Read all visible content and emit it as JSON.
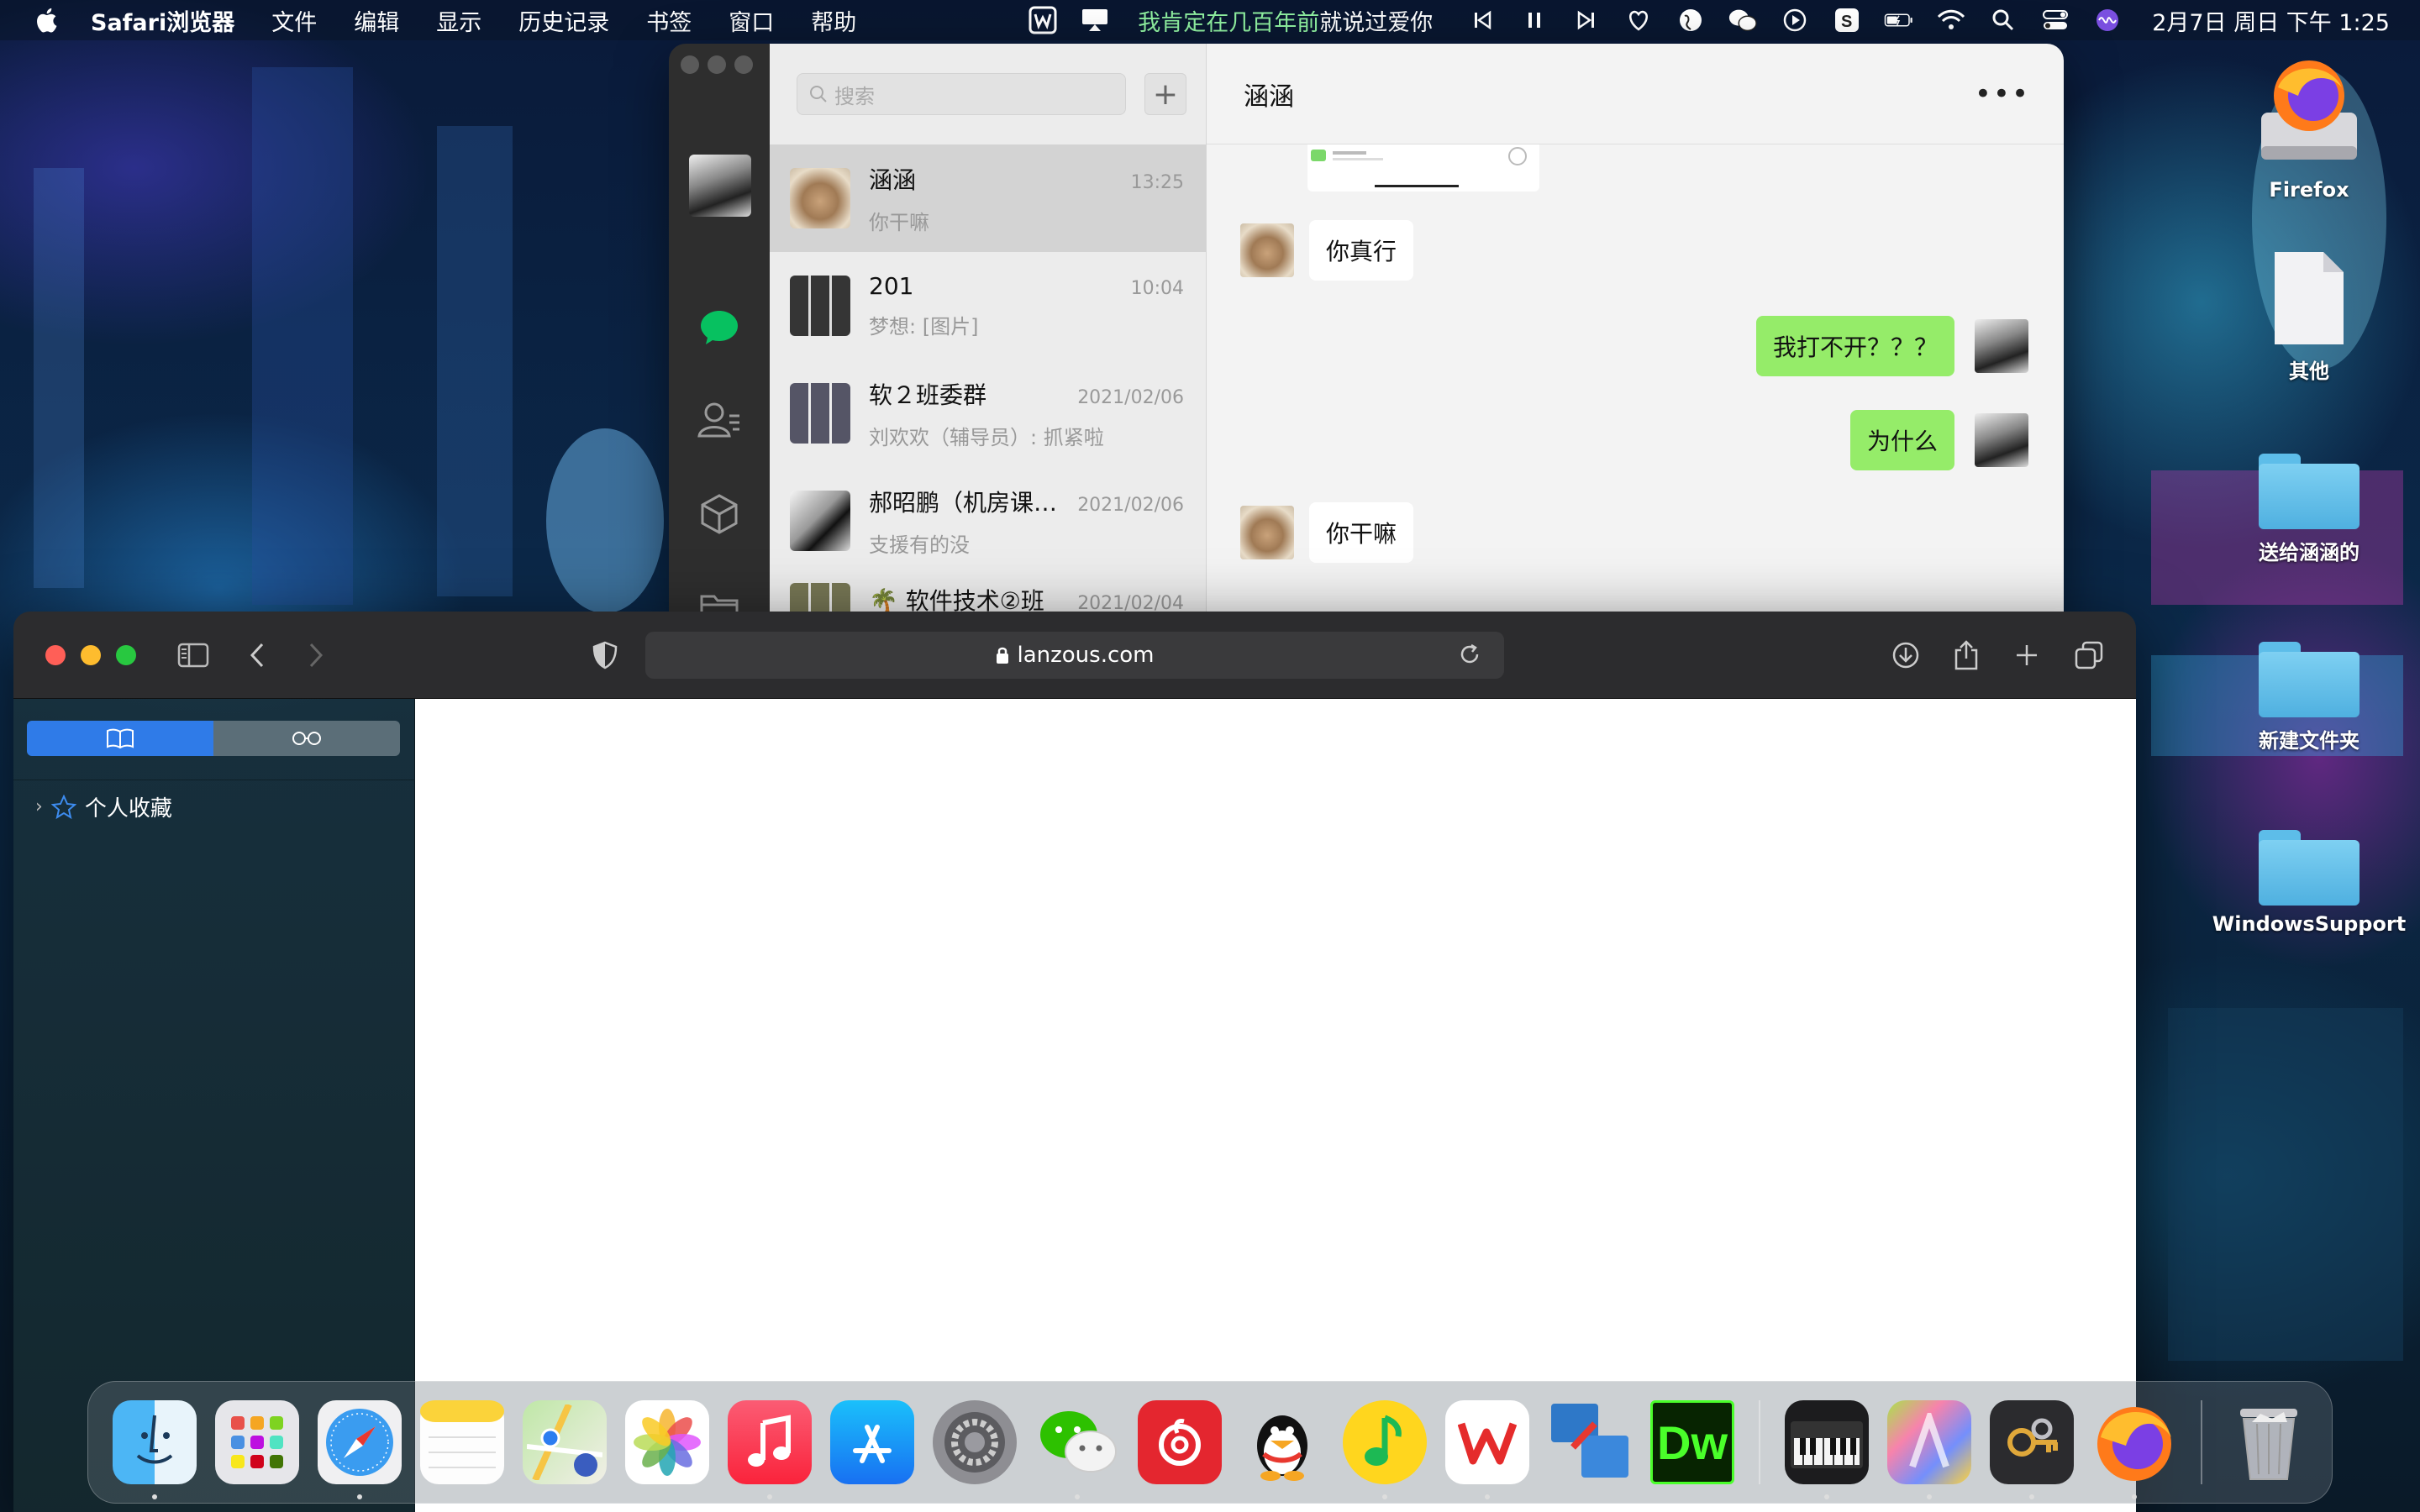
{
  "menubar": {
    "app_name": "Safari浏览器",
    "items": [
      "文件",
      "编辑",
      "显示",
      "历史记录",
      "书签",
      "窗口",
      "帮助"
    ],
    "song_highlight": "我肯定在几百年前",
    "song_rest": "就说过爱你",
    "clock": "2月7日 周日 下午 1:25"
  },
  "wechat": {
    "search_placeholder": "搜索",
    "add_label": "+",
    "conversations": [
      {
        "name": "涵涵",
        "time": "13:25",
        "message": "你干嘛"
      },
      {
        "name": "201",
        "time": "10:04",
        "message": "梦想: [图片]"
      },
      {
        "name": "软２班委群",
        "time": "2021/02/06",
        "message": "刘欢欢（辅导员）: 抓紧啦"
      },
      {
        "name": "郝昭鹏（机房课…",
        "time": "2021/02/06",
        "message": "支援有的没"
      },
      {
        "name": "🌴 软件技术②班",
        "time": "2021/02/04",
        "message": ""
      }
    ],
    "chat": {
      "title": "涵涵",
      "more": "•••",
      "messages": [
        {
          "from": "them",
          "text": "你真行"
        },
        {
          "from": "me",
          "text": "我打不开？？？"
        },
        {
          "from": "me",
          "text": "为什么"
        },
        {
          "from": "them",
          "text": "你干嘛"
        }
      ]
    }
  },
  "safari": {
    "url": "lanzous.com",
    "sidebar": {
      "favorites_label": "个人收藏",
      "chevron": "›"
    }
  },
  "desktop_icons": [
    {
      "label": "Firefox"
    },
    {
      "label": "其他"
    },
    {
      "label": "送给涵涵的"
    },
    {
      "label": "新建文件夹"
    },
    {
      "label": "WindowsSupport"
    }
  ],
  "dock": {
    "apps": [
      "finder-icon",
      "launchpad-icon",
      "safari-icon",
      "notes-icon",
      "maps-icon",
      "photos-icon",
      "music-icon",
      "app-store-icon",
      "system-preferences-icon",
      "wechat-icon",
      "netease-music-icon",
      "qq-icon",
      "qq-music-icon",
      "wps-icon",
      "vmware-icon",
      "dreamweaver-icon",
      "piano-icon",
      "gradient-app-icon",
      "keychain-icon",
      "firefox-icon",
      "trash-icon"
    ],
    "dw_label": "Dw"
  },
  "colors": {
    "wechat_green": "#95ec69",
    "safari_accent": "#2f7be8",
    "menubar_song": "#8ff0a0"
  }
}
